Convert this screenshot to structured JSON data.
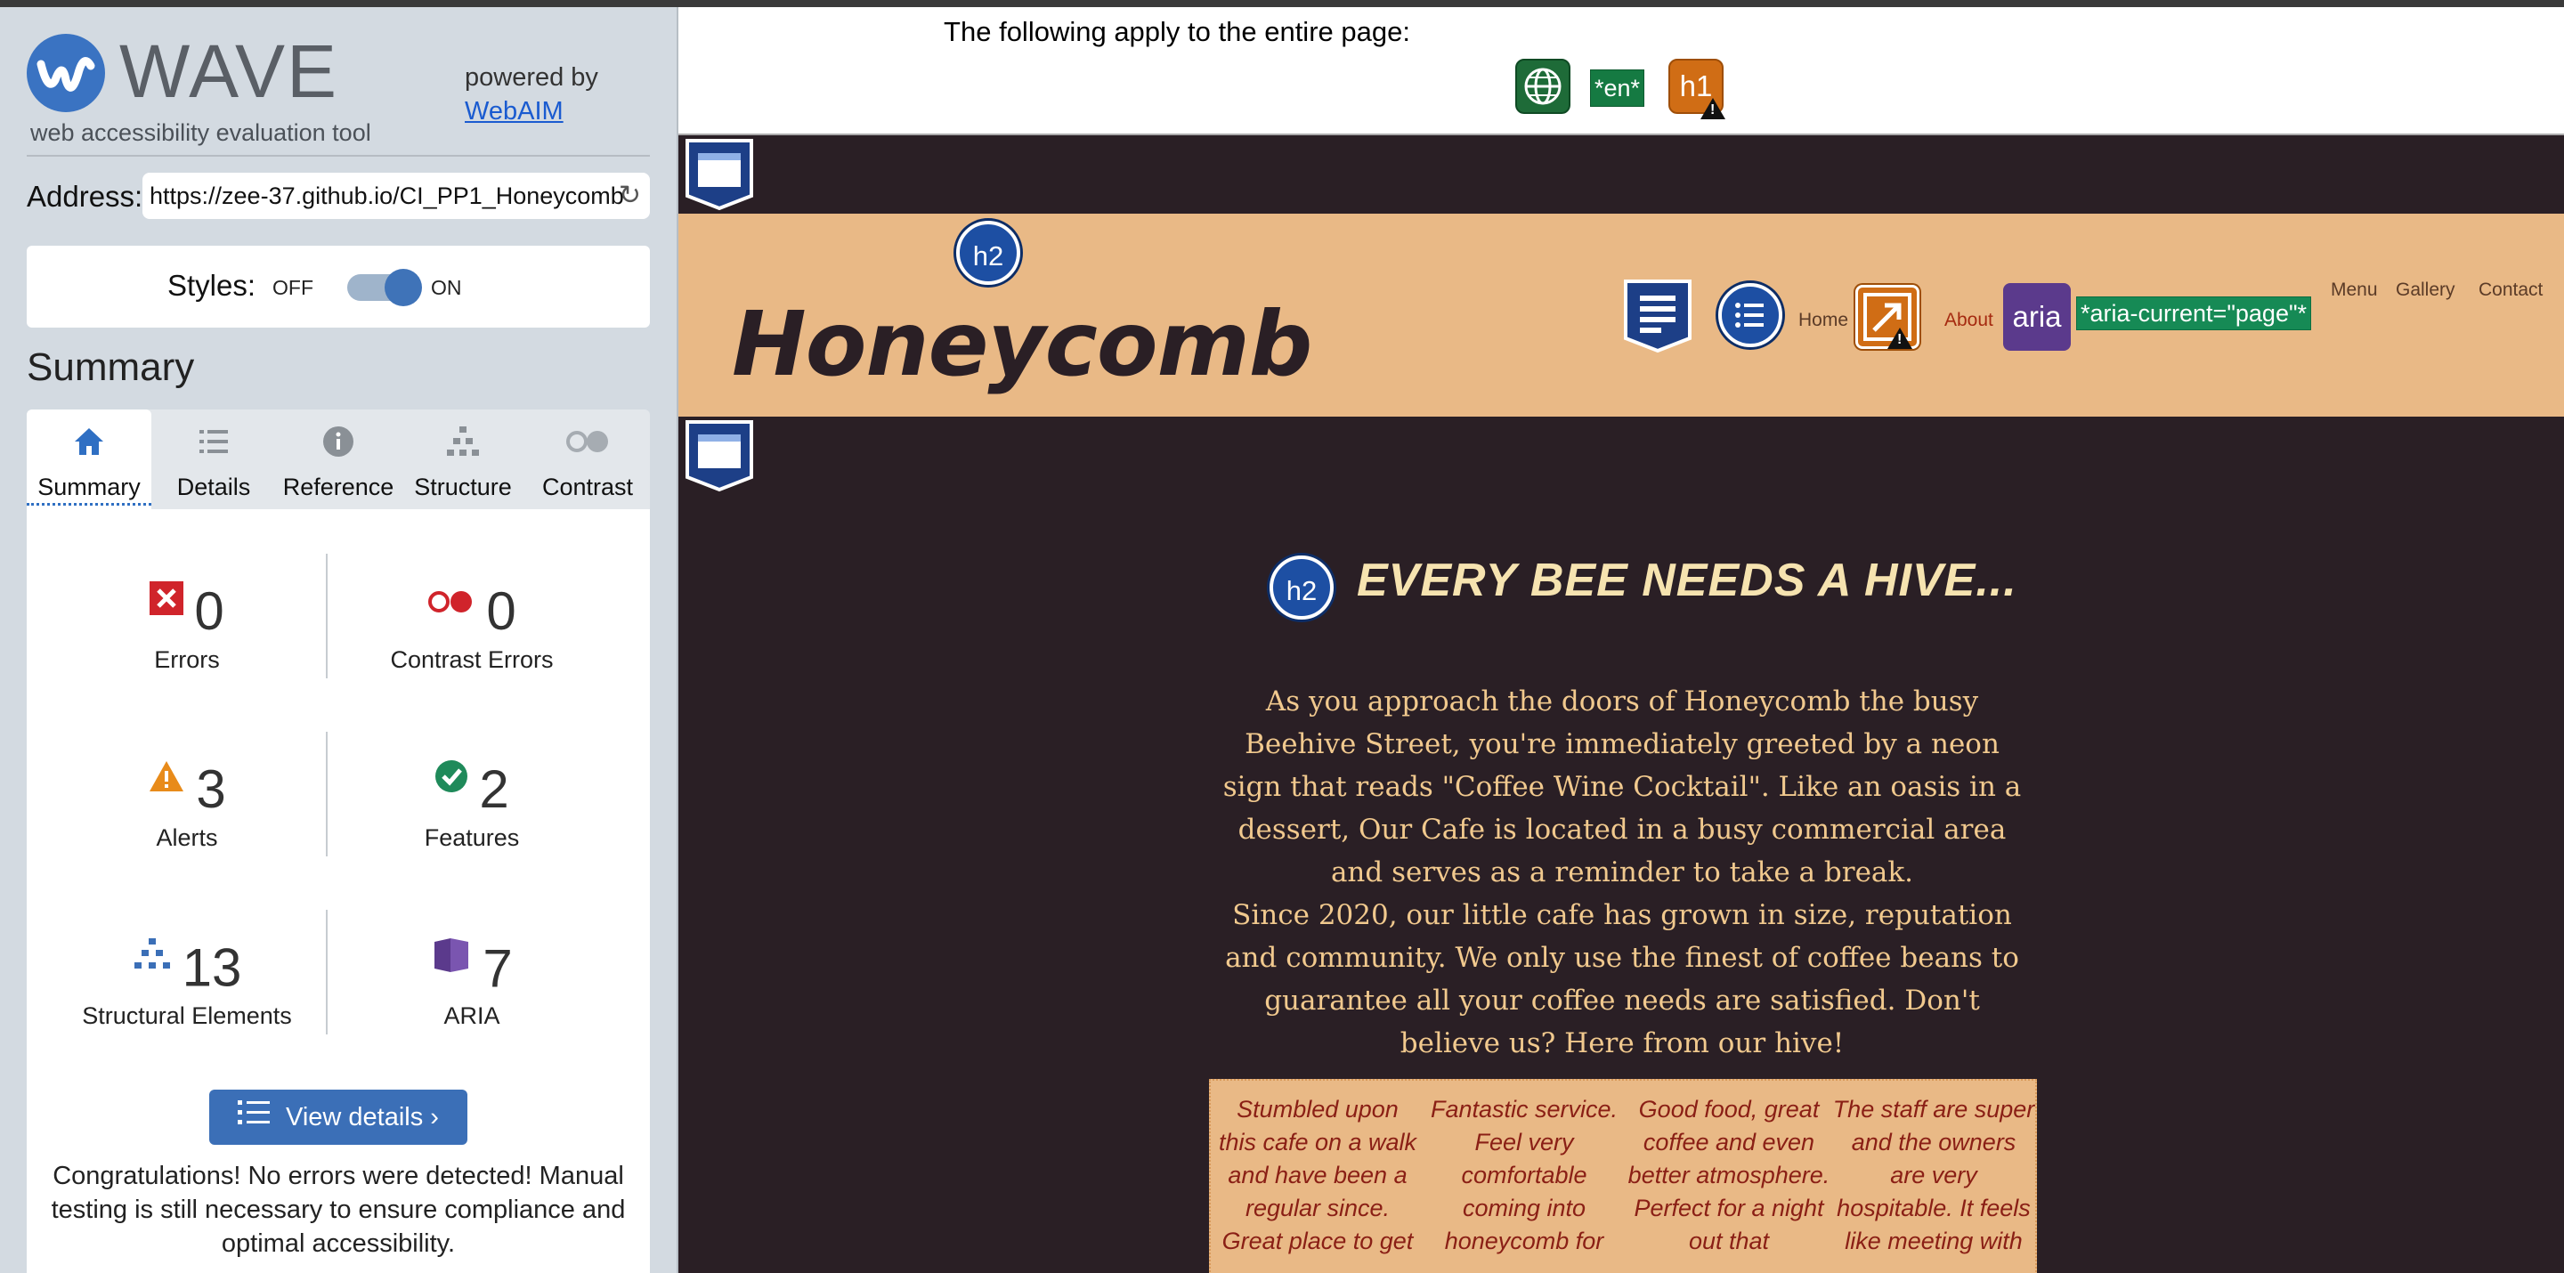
{
  "wave": {
    "brand": "WAVE",
    "tagline": "web accessibility evaluation tool",
    "powered_by": "powered by",
    "webaim_link": "WebAIM",
    "address_label": "Address:",
    "address_value": "https://zee-37.github.io/CI_PP1_Honeycomb",
    "styles_label": "Styles:",
    "styles_off": "OFF",
    "styles_on": "ON",
    "summary_heading": "Summary",
    "tabs": [
      {
        "label": "Summary",
        "icon": "home-icon",
        "active": true
      },
      {
        "label": "Details",
        "icon": "list-icon",
        "active": false
      },
      {
        "label": "Reference",
        "icon": "info-icon",
        "active": false
      },
      {
        "label": "Structure",
        "icon": "hierarchy-icon",
        "active": false
      },
      {
        "label": "Contrast",
        "icon": "contrast-icon",
        "active": false
      }
    ],
    "stats": {
      "errors": {
        "value": "0",
        "label": "Errors"
      },
      "contrast_errors": {
        "value": "0",
        "label": "Contrast Errors"
      },
      "alerts": {
        "value": "3",
        "label": "Alerts"
      },
      "features": {
        "value": "2",
        "label": "Features"
      },
      "structural": {
        "value": "13",
        "label": "Structural Elements"
      },
      "aria": {
        "value": "7",
        "label": "ARIA"
      }
    },
    "view_details": "View details ›",
    "congrats": "Congratulations! No errors were detected! Manual testing is still necessary to ensure compliance and optimal accessibility."
  },
  "page": {
    "apply_text": "The following apply to the entire page:",
    "lang_tag": "*en*",
    "h1_badge": "h1",
    "h2_badge": "h2",
    "aria_badge": "aria",
    "aria_current": "*aria-current=\"page\"*",
    "site_title": "Honeycomb",
    "nav": {
      "home": "Home",
      "about": "About",
      "menu": "Menu",
      "gallery": "Gallery",
      "contact": "Contact"
    },
    "hero_heading": "EVERY BEE NEEDS A HIVE...",
    "hero_p1": "As you approach the doors of Honeycomb the busy Beehive Street, you're immediately greeted by a neon sign that reads \"Coffee Wine Cocktail\". Like an oasis in a dessert, Our Cafe is located in a busy commercial area and serves as a reminder to take a break.",
    "hero_p2": "Since 2020, our little cafe has grown in size, reputation and community. We only use the finest of coffee beans to guarantee all your coffee needs are satisfied. Don't believe us? Here from our hive!",
    "reviews": [
      "Stumbled upon this cafe on a walk and have been a regular since. Great place to get",
      "Fantastic service. Feel very comfortable coming into honeycomb for",
      "Good food, great coffee and even better atmosphere. Perfect for a night out that",
      "The staff are super and the owners are very hospitable. It feels like meeting with"
    ]
  },
  "colors": {
    "accent": "#3b6fb7",
    "header_band": "#e9b986",
    "page_bg": "#2a1f25",
    "hero_text": "#f1c98e"
  }
}
